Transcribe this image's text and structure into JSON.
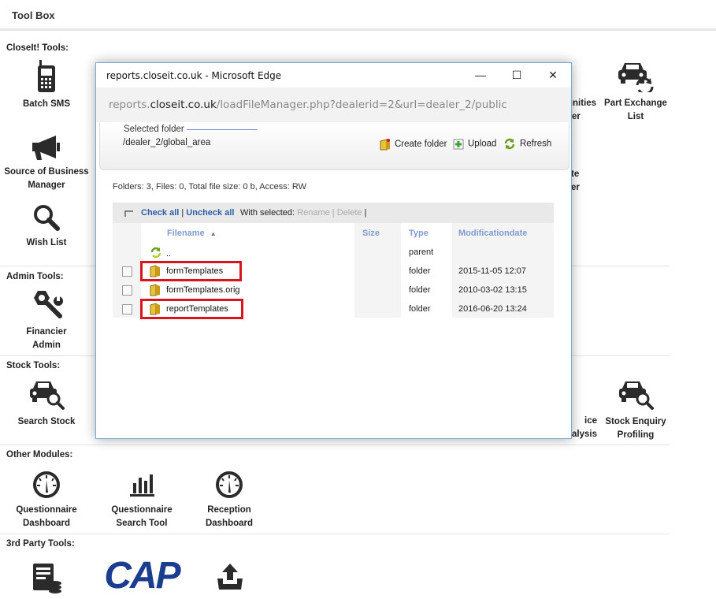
{
  "toolbox": {
    "title": "Tool Box"
  },
  "sections": {
    "closeit": "CloseIt! Tools:",
    "admin": "Admin Tools:",
    "stock": "Stock Tools:",
    "other": "Other Modules:",
    "third": "3rd Party Tools:"
  },
  "tools": {
    "batch_sms": "Batch SMS",
    "part_exchange_list": "Part Exchange List",
    "opportunities_partial": "unities",
    "opportunities_partial2": "er",
    "source_business_manager": "Source of Business Manager",
    "te_partial": "te",
    "er_partial": "er",
    "wish_list": "Wish List",
    "financier_admin": "Financier Admin",
    "search_stock": "Search Stock",
    "price_analysis_partial": "ice",
    "price_analysis_partial2": "alysis",
    "stock_enquiry_profiling": "Stock Enquiry Profiling",
    "questionnaire_dashboard": "Questionnaire Dashboard",
    "questionnaire_search_tool": "Questionnaire Search Tool",
    "reception_dashboard": "Reception Dashboard",
    "cap_logo": "CAP"
  },
  "edge": {
    "title": "reports.closeit.co.uk - Microsoft Edge",
    "url_prefix": "reports.",
    "url_domain": "closeit.co.uk",
    "url_rest": "/loadFileManager.php?dealerid=2&url=dealer_2/public",
    "minimize": "—",
    "maximize": "☐",
    "close": "✕"
  },
  "file_manager": {
    "selected_folder_label": "Selected folder",
    "selected_folder_path": "/dealer_2/global_area",
    "create_folder": "Create folder",
    "upload": "Upload",
    "refresh": "Refresh",
    "stats": "Folders: 3, Files: 0, Total file size: 0 b, Access: RW",
    "check_all": "Check all",
    "separator": "|",
    "uncheck_all": "Uncheck all",
    "with_selected": "With selected:",
    "rename": "Rename",
    "delete": "Delete",
    "columns": {
      "filename": "Filename",
      "sort_arrow": "▲",
      "size": "Size",
      "type": "Type",
      "modification": "Modificationdate"
    },
    "rows": [
      {
        "name": "..",
        "type": "parent",
        "date": ""
      },
      {
        "name": "formTemplates",
        "type": "folder",
        "date": "2015-11-05 12:07"
      },
      {
        "name": "formTemplates.orig",
        "type": "folder",
        "date": "2010-03-02 13:15"
      },
      {
        "name": "reportTemplates",
        "type": "folder",
        "date": "2016-06-20 13:24"
      }
    ]
  },
  "colors": {
    "highlight": "#d9141c",
    "link": "#2d5fa8",
    "header_text": "#7f9bd0"
  }
}
